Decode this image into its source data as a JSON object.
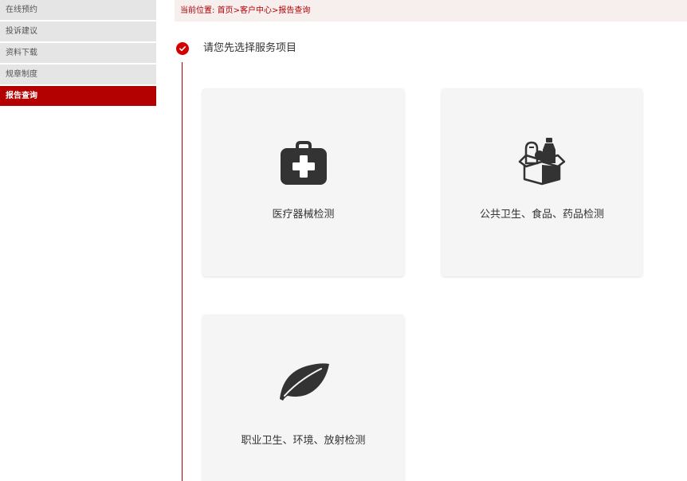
{
  "sidebar": {
    "items": [
      {
        "label": "在线预约"
      },
      {
        "label": "投诉建议"
      },
      {
        "label": "资料下载"
      },
      {
        "label": "规章制度"
      },
      {
        "label": "报告查询",
        "active": true
      }
    ]
  },
  "breadcrumb": {
    "prefix": "当前位置:",
    "home": "首页",
    "sep1": ">",
    "section": "客户中心",
    "sep2": ">",
    "current": "报告查询"
  },
  "step": {
    "title": "请您先选择服务项目"
  },
  "cards": [
    {
      "label": "医疗器械检测",
      "icon": "medical-kit-icon"
    },
    {
      "label": "公共卫生、食品、药品检测",
      "icon": "grocery-box-icon"
    },
    {
      "label": "职业卫生、环境、放射检测",
      "icon": "leaf-icon"
    }
  ],
  "colors": {
    "accent": "#b30000",
    "breadcrumb_bg": "#f7eeee",
    "sidebar_bg": "#e5e5e5",
    "card_bg": "#f5f5f5",
    "icon": "#333333"
  }
}
